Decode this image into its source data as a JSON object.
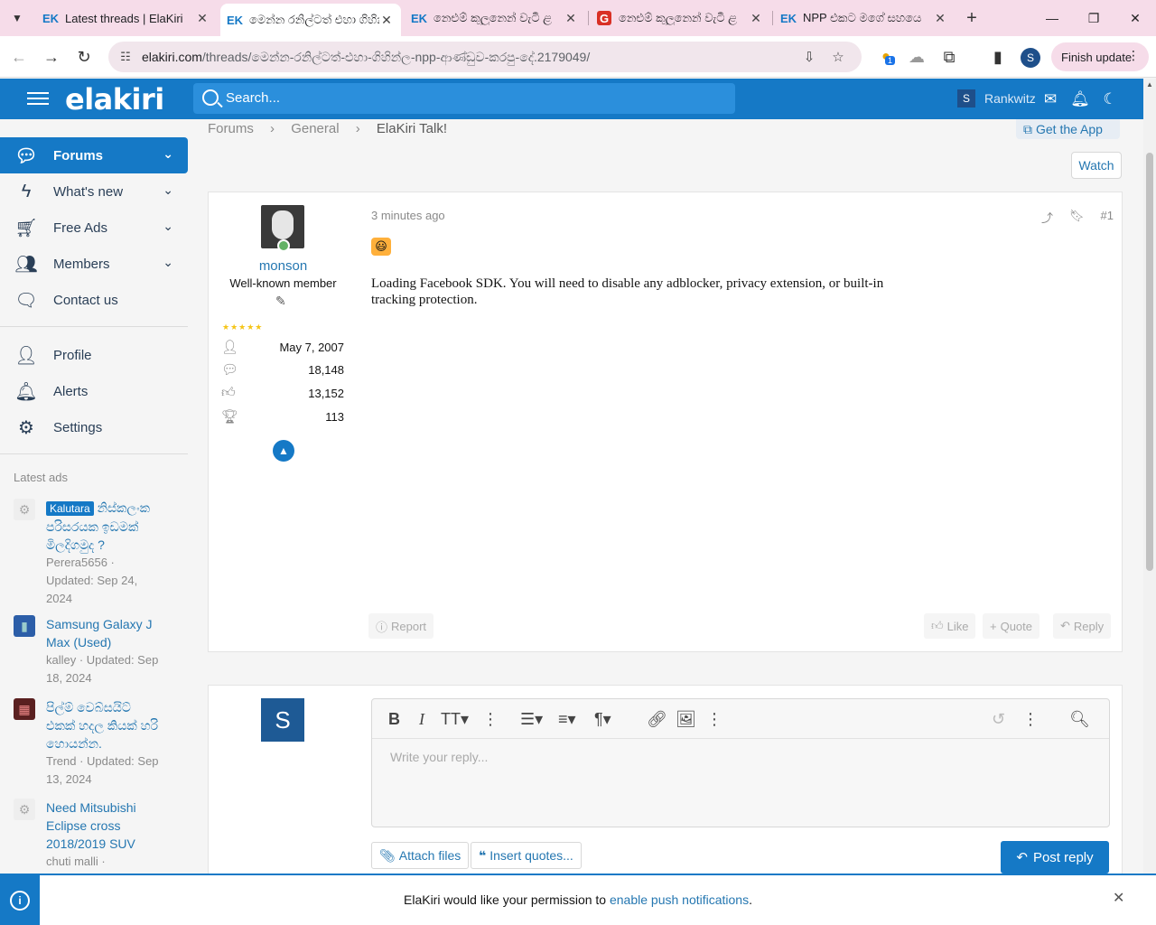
{
  "browser": {
    "tabs": [
      {
        "label": "Latest threads | ElaKiri",
        "favicon": "EK"
      },
      {
        "label": "මෙන්න රනිල්ටත් එහා ගිහින්ල",
        "favicon": "EK"
      },
      {
        "label": "නෙළුම් කුලුනෙන් වැටී ළ",
        "favicon": "EK"
      },
      {
        "label": "නෙළුම් කුලුනෙන් වැටී ළ",
        "favicon": "G"
      },
      {
        "label": "NPP එකට මගේ සහයෙ",
        "favicon": "EK"
      }
    ],
    "url_host": "elakiri.com",
    "url_path": "/threads/මෙන්න-රනිල්ටත්-එහා-ගිහින්ල-npp-ආණ්ඩුව-කරපු-දේ.2179049/",
    "profile_initial": "S",
    "finish_update": "Finish update",
    "extension_badge": "1"
  },
  "header": {
    "logo": "elakiri",
    "search_placeholder": "Search...",
    "user_initial": "S",
    "username": "Rankwitz"
  },
  "sidebar": {
    "nav": [
      {
        "label": "Forums"
      },
      {
        "label": "What's new"
      },
      {
        "label": "Free Ads"
      },
      {
        "label": "Members"
      },
      {
        "label": "Contact us"
      }
    ],
    "account": [
      {
        "label": "Profile"
      },
      {
        "label": "Alerts"
      },
      {
        "label": "Settings"
      }
    ],
    "latest_ads_title": "Latest ads",
    "ads": [
      {
        "badge": "Kalutara",
        "title": "නිස්කලංක පරිසරයක ඉඩමක් මිලදිගමුද ?",
        "meta": "Perera5656 · Updated: Sep 24, 2024"
      },
      {
        "title": "Samsung Galaxy J Max (Used)",
        "meta": "kalley · Updated: Sep 18, 2024"
      },
      {
        "title": "පිල්ම් වෙබ්සයිට් එකක් හදල කියක් හරි හොයන්න.",
        "meta": "Trend · Updated: Sep 13, 2024"
      },
      {
        "title": "Need Mitsubishi Eclipse cross 2018/2019 SUV",
        "meta": "chuti malli ·"
      }
    ]
  },
  "breadcrumb": [
    "Forums",
    "General",
    "ElaKiri Talk!"
  ],
  "get_app": "Get the App",
  "watch": "Watch",
  "post": {
    "username": "monson",
    "user_title": "Well-known member",
    "joined": "May 7, 2007",
    "messages": "18,148",
    "reactions": "13,152",
    "points": "113",
    "time": "3 minutes ago",
    "number": "#1",
    "text": "Loading Facebook SDK. You will need to disable any adblocker, privacy extension, or built-in tracking protection.",
    "report": "Report",
    "like": "Like",
    "quote": "Quote",
    "reply": "Reply"
  },
  "reply_box": {
    "avatar_initial": "S",
    "placeholder": "Write your reply...",
    "attach": "Attach files",
    "insert_quotes": "Insert quotes...",
    "post_reply": "Post reply"
  },
  "notice": {
    "text_before": "ElaKiri would like your permission to ",
    "link": "enable push notifications",
    "text_after": "."
  },
  "colors": {
    "brand": "#1579c6",
    "link": "#2577b1",
    "tabbar": "#f6dce9"
  }
}
